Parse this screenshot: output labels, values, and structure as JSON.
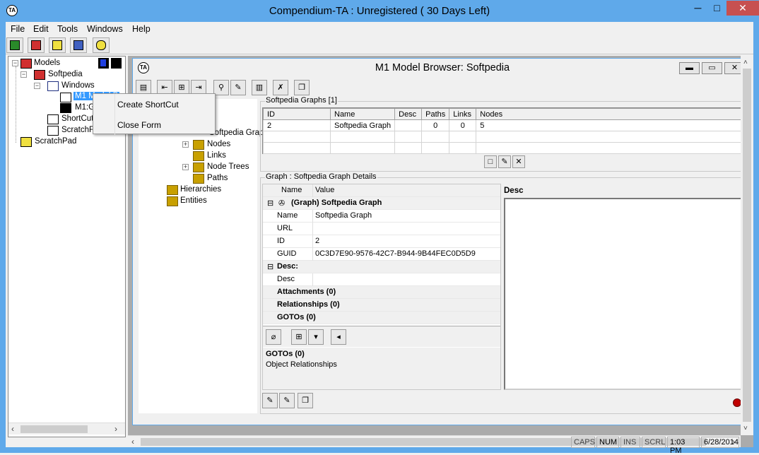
{
  "window": {
    "title": "Compendium-TA : Unregistered ( 30 Days Left)",
    "app_icon_text": "TA",
    "minimize": "─",
    "maximize": "□",
    "close": "✕"
  },
  "menu": [
    "File",
    "Edit",
    "Tools",
    "Windows",
    "Help"
  ],
  "tree": {
    "root": "Models",
    "softpedia": "Softpedia",
    "windows": "Windows",
    "m1_node": "M1 Model B",
    "m1_graph": "M1:Graph",
    "shortcuts": "ShortCuts",
    "scratchf": "ScratchForms",
    "scratchpad": "ScratchPad"
  },
  "context_menu": {
    "create_shortcut": "Create ShortCut",
    "close_form": "Close Form"
  },
  "child_window": {
    "title": "M1 Model Browser: Softpedia",
    "icon_text": "TA"
  },
  "child_tree": {
    "graph_item": "Softpedia Graph",
    "nodes": "Nodes",
    "links": "Links",
    "node_trees": "Node Trees",
    "paths": "Paths",
    "hierarchies": "Hierarchies",
    "entities": "Entities"
  },
  "graphs_panel": {
    "label": "Softpedia Graphs [1]",
    "columns": [
      "ID",
      "Name",
      "Desc",
      "Paths",
      "Links",
      "Nodes"
    ],
    "rows": [
      [
        "2",
        "Softpedia Graph",
        "",
        "0",
        "0",
        "5"
      ]
    ]
  },
  "details_panel": {
    "label": "Graph : Softpedia Graph Details",
    "col_name": "Name",
    "col_value": "Value",
    "graph_header": "(Graph) Softpedia Graph",
    "props": [
      {
        "k": "Name",
        "v": "Softpedia Graph"
      },
      {
        "k": "URL",
        "v": ""
      },
      {
        "k": "ID",
        "v": "2"
      },
      {
        "k": "GUID",
        "v": "0C3D7E90-9576-42C7-B944-9B44FEC0D5D9"
      }
    ],
    "desc_header": "Desc:",
    "desc_key": "Desc",
    "attachments": "Attachments (0)",
    "relationships": "Relationships (0)",
    "gotos": "GOTOs (0)",
    "info_title": "GOTOs (0)",
    "info_sub": "Object Relationships",
    "desc_panel_label": "Desc"
  },
  "status": {
    "caps": "CAPS",
    "num": "NUM",
    "ins": "INS",
    "scrl": "SCRL",
    "time": "1:03 PM",
    "date": "6/28/2014"
  },
  "colors": {
    "title_accent": "#5fa9ea",
    "close_red": "#c75050",
    "folder": "#c8a000"
  }
}
